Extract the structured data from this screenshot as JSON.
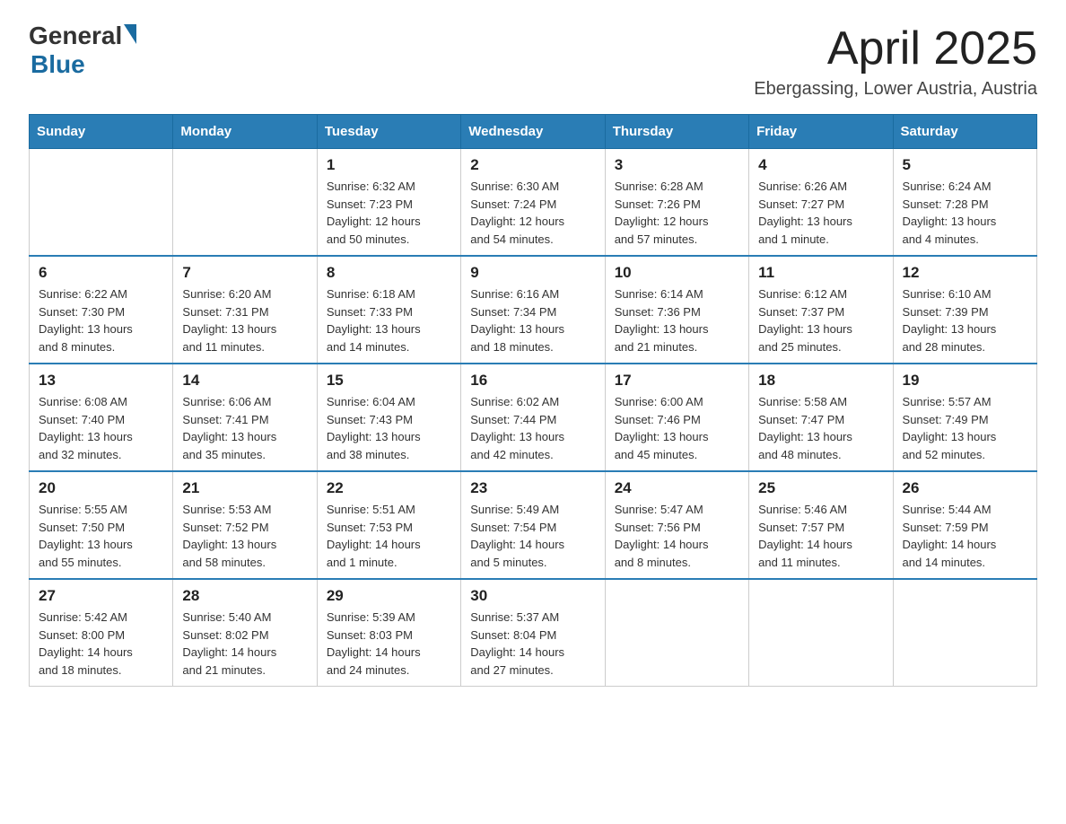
{
  "header": {
    "logo_general": "General",
    "logo_blue": "Blue",
    "month_year": "April 2025",
    "location": "Ebergassing, Lower Austria, Austria"
  },
  "days_of_week": [
    "Sunday",
    "Monday",
    "Tuesday",
    "Wednesday",
    "Thursday",
    "Friday",
    "Saturday"
  ],
  "weeks": [
    [
      {
        "day": "",
        "info": ""
      },
      {
        "day": "",
        "info": ""
      },
      {
        "day": "1",
        "info": "Sunrise: 6:32 AM\nSunset: 7:23 PM\nDaylight: 12 hours\nand 50 minutes."
      },
      {
        "day": "2",
        "info": "Sunrise: 6:30 AM\nSunset: 7:24 PM\nDaylight: 12 hours\nand 54 minutes."
      },
      {
        "day": "3",
        "info": "Sunrise: 6:28 AM\nSunset: 7:26 PM\nDaylight: 12 hours\nand 57 minutes."
      },
      {
        "day": "4",
        "info": "Sunrise: 6:26 AM\nSunset: 7:27 PM\nDaylight: 13 hours\nand 1 minute."
      },
      {
        "day": "5",
        "info": "Sunrise: 6:24 AM\nSunset: 7:28 PM\nDaylight: 13 hours\nand 4 minutes."
      }
    ],
    [
      {
        "day": "6",
        "info": "Sunrise: 6:22 AM\nSunset: 7:30 PM\nDaylight: 13 hours\nand 8 minutes."
      },
      {
        "day": "7",
        "info": "Sunrise: 6:20 AM\nSunset: 7:31 PM\nDaylight: 13 hours\nand 11 minutes."
      },
      {
        "day": "8",
        "info": "Sunrise: 6:18 AM\nSunset: 7:33 PM\nDaylight: 13 hours\nand 14 minutes."
      },
      {
        "day": "9",
        "info": "Sunrise: 6:16 AM\nSunset: 7:34 PM\nDaylight: 13 hours\nand 18 minutes."
      },
      {
        "day": "10",
        "info": "Sunrise: 6:14 AM\nSunset: 7:36 PM\nDaylight: 13 hours\nand 21 minutes."
      },
      {
        "day": "11",
        "info": "Sunrise: 6:12 AM\nSunset: 7:37 PM\nDaylight: 13 hours\nand 25 minutes."
      },
      {
        "day": "12",
        "info": "Sunrise: 6:10 AM\nSunset: 7:39 PM\nDaylight: 13 hours\nand 28 minutes."
      }
    ],
    [
      {
        "day": "13",
        "info": "Sunrise: 6:08 AM\nSunset: 7:40 PM\nDaylight: 13 hours\nand 32 minutes."
      },
      {
        "day": "14",
        "info": "Sunrise: 6:06 AM\nSunset: 7:41 PM\nDaylight: 13 hours\nand 35 minutes."
      },
      {
        "day": "15",
        "info": "Sunrise: 6:04 AM\nSunset: 7:43 PM\nDaylight: 13 hours\nand 38 minutes."
      },
      {
        "day": "16",
        "info": "Sunrise: 6:02 AM\nSunset: 7:44 PM\nDaylight: 13 hours\nand 42 minutes."
      },
      {
        "day": "17",
        "info": "Sunrise: 6:00 AM\nSunset: 7:46 PM\nDaylight: 13 hours\nand 45 minutes."
      },
      {
        "day": "18",
        "info": "Sunrise: 5:58 AM\nSunset: 7:47 PM\nDaylight: 13 hours\nand 48 minutes."
      },
      {
        "day": "19",
        "info": "Sunrise: 5:57 AM\nSunset: 7:49 PM\nDaylight: 13 hours\nand 52 minutes."
      }
    ],
    [
      {
        "day": "20",
        "info": "Sunrise: 5:55 AM\nSunset: 7:50 PM\nDaylight: 13 hours\nand 55 minutes."
      },
      {
        "day": "21",
        "info": "Sunrise: 5:53 AM\nSunset: 7:52 PM\nDaylight: 13 hours\nand 58 minutes."
      },
      {
        "day": "22",
        "info": "Sunrise: 5:51 AM\nSunset: 7:53 PM\nDaylight: 14 hours\nand 1 minute."
      },
      {
        "day": "23",
        "info": "Sunrise: 5:49 AM\nSunset: 7:54 PM\nDaylight: 14 hours\nand 5 minutes."
      },
      {
        "day": "24",
        "info": "Sunrise: 5:47 AM\nSunset: 7:56 PM\nDaylight: 14 hours\nand 8 minutes."
      },
      {
        "day": "25",
        "info": "Sunrise: 5:46 AM\nSunset: 7:57 PM\nDaylight: 14 hours\nand 11 minutes."
      },
      {
        "day": "26",
        "info": "Sunrise: 5:44 AM\nSunset: 7:59 PM\nDaylight: 14 hours\nand 14 minutes."
      }
    ],
    [
      {
        "day": "27",
        "info": "Sunrise: 5:42 AM\nSunset: 8:00 PM\nDaylight: 14 hours\nand 18 minutes."
      },
      {
        "day": "28",
        "info": "Sunrise: 5:40 AM\nSunset: 8:02 PM\nDaylight: 14 hours\nand 21 minutes."
      },
      {
        "day": "29",
        "info": "Sunrise: 5:39 AM\nSunset: 8:03 PM\nDaylight: 14 hours\nand 24 minutes."
      },
      {
        "day": "30",
        "info": "Sunrise: 5:37 AM\nSunset: 8:04 PM\nDaylight: 14 hours\nand 27 minutes."
      },
      {
        "day": "",
        "info": ""
      },
      {
        "day": "",
        "info": ""
      },
      {
        "day": "",
        "info": ""
      }
    ]
  ]
}
